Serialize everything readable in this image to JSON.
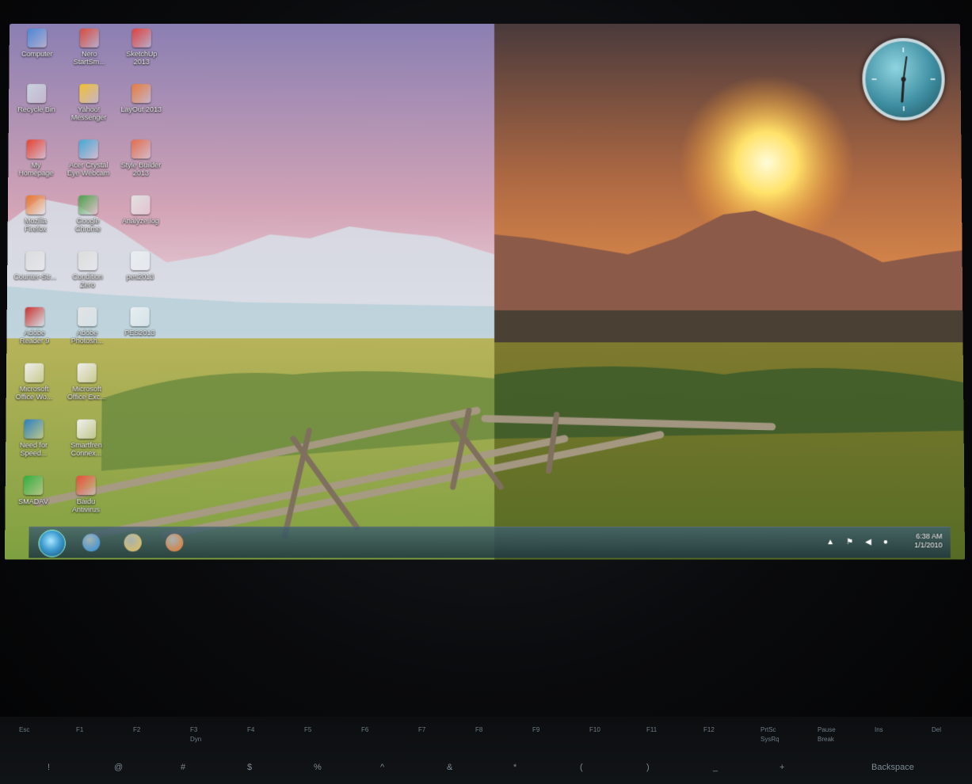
{
  "desktop_icons": [
    {
      "id": "computer",
      "label": "Computer",
      "icon": "computer-icon",
      "color": "#4a88d8",
      "col": 0,
      "row": 0
    },
    {
      "id": "nero",
      "label": "Nero\nStartSm...",
      "icon": "nero-icon",
      "color": "#d94b3b",
      "col": 1,
      "row": 0
    },
    {
      "id": "sketchup",
      "label": "SketchUp\n2013",
      "icon": "sketchup-icon",
      "color": "#e0413a",
      "col": 2,
      "row": 0
    },
    {
      "id": "recycle",
      "label": "Recycle Bin",
      "icon": "recycle-bin-icon",
      "color": "#c8d4e0",
      "col": 0,
      "row": 1
    },
    {
      "id": "yahoo",
      "label": "Yahoo!\nMessenger",
      "icon": "yahoo-messenger-icon",
      "color": "#f2c230",
      "col": 1,
      "row": 1
    },
    {
      "id": "layout",
      "label": "LayOut 2013",
      "icon": "layout-icon",
      "color": "#e87c3a",
      "col": 2,
      "row": 1
    },
    {
      "id": "myhomepage",
      "label": "My\nHomepage",
      "icon": "homepage-icon",
      "color": "#e7402f",
      "col": 0,
      "row": 2
    },
    {
      "id": "acer",
      "label": "Acer Crystal\nEye Webcam",
      "icon": "webcam-icon",
      "color": "#43a9d6",
      "col": 1,
      "row": 2
    },
    {
      "id": "stylebuilder",
      "label": "Style Builder\n2013",
      "icon": "style-builder-icon",
      "color": "#e46d4a",
      "col": 2,
      "row": 2
    },
    {
      "id": "firefox",
      "label": "Mozilla\nFirefox",
      "icon": "firefox-icon",
      "color": "#e8772a",
      "col": 0,
      "row": 3
    },
    {
      "id": "chrome",
      "label": "Google\nChrome",
      "icon": "chrome-icon",
      "color": "#4aa04a",
      "col": 1,
      "row": 3
    },
    {
      "id": "analyzelog",
      "label": "Analyze.log",
      "icon": "log-file-icon",
      "color": "#e2e2e2",
      "col": 2,
      "row": 3
    },
    {
      "id": "counterstrike",
      "label": "Counter-Str...",
      "icon": "counter-strike-icon",
      "color": "#dcdcdc",
      "col": 0,
      "row": 4
    },
    {
      "id": "condition",
      "label": "Condition\nZero",
      "icon": "condition-zero-icon",
      "color": "#dcdcdc",
      "col": 1,
      "row": 4
    },
    {
      "id": "pes2013a",
      "label": "pes2013",
      "icon": "pes-icon",
      "color": "#e6eef2",
      "col": 2,
      "row": 4
    },
    {
      "id": "adobereader",
      "label": "Adobe\nReader 9",
      "icon": "adobe-reader-icon",
      "color": "#c9302c",
      "col": 0,
      "row": 5
    },
    {
      "id": "photoshop",
      "label": "Adobe\nPhotosh...",
      "icon": "photoshop-icon",
      "color": "#e3e3e3",
      "col": 1,
      "row": 5
    },
    {
      "id": "pes2013b",
      "label": "PES2013",
      "icon": "pes-icon",
      "color": "#e6eef2",
      "col": 2,
      "row": 5
    },
    {
      "id": "msword",
      "label": "Microsoft\nOffice Wo...",
      "icon": "document-icon",
      "color": "#eeeeee",
      "col": 0,
      "row": 6
    },
    {
      "id": "msexcel",
      "label": "Microsoft\nOffice Exc...",
      "icon": "document-icon",
      "color": "#eeeeee",
      "col": 1,
      "row": 6
    },
    {
      "id": "nfs",
      "label": "Need for\nSpeed...",
      "icon": "need-for-speed-icon",
      "color": "#2a7fc0",
      "col": 0,
      "row": 7
    },
    {
      "id": "smartfren",
      "label": "Smartfren\nConnex...",
      "icon": "smartfren-icon",
      "color": "#f0f0f0",
      "col": 1,
      "row": 7
    },
    {
      "id": "smadav",
      "label": "SMADAV",
      "icon": "smadav-icon",
      "color": "#2fae3f",
      "col": 0,
      "row": 8
    },
    {
      "id": "baidu",
      "label": "Baidu\nAntivirus",
      "icon": "baidu-antivirus-icon",
      "color": "#e84b3b",
      "col": 1,
      "row": 8
    }
  ],
  "taskbar": {
    "start": "start-orb-icon",
    "pinned": [
      {
        "icon": "internet-explorer-icon",
        "color": "#2c8fe0"
      },
      {
        "icon": "folder-icon",
        "color": "#e8c25a"
      },
      {
        "icon": "firefox-icon",
        "color": "#e8772a"
      }
    ],
    "time": "6:38 AM",
    "date": "1/1/2010"
  },
  "keyboard": {
    "fkeys": [
      "Esc",
      "F1",
      "F2",
      "F3",
      "F4",
      "F5",
      "F6",
      "F7",
      "F8",
      "F9",
      "F10",
      "F11",
      "F12",
      "PrtSc",
      "Pause",
      "Ins",
      "Del"
    ],
    "fkey_subs": {
      "F3": "Dyn",
      "PrtSc": "SysRq",
      "Pause": "Break"
    },
    "symbols": [
      "!",
      "@",
      "#",
      "$",
      "%",
      "^",
      "&",
      "*",
      "(",
      ")",
      "_",
      "+",
      "Backspace"
    ]
  },
  "colors": {
    "sky_left": "#c6a6b8",
    "sky_right": "#d47a3a",
    "grass": "#8a9a3a",
    "taskbar": "#2f4a56"
  }
}
